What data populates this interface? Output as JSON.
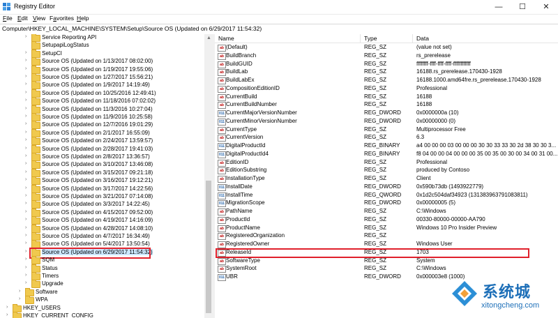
{
  "window": {
    "title": "Registry Editor",
    "minimize": "—",
    "maximize": "☐",
    "close": "✕"
  },
  "menu": [
    {
      "label": "File",
      "u": "F",
      "rest": "ile"
    },
    {
      "label": "Edit",
      "u": "E",
      "rest": "dit"
    },
    {
      "label": "View",
      "u": "V",
      "rest": "iew"
    },
    {
      "label": "Favorites",
      "u": "a",
      "pre": "F",
      "rest": "vorites"
    },
    {
      "label": "Help",
      "u": "H",
      "rest": "elp"
    }
  ],
  "address": "Computer\\HKEY_LOCAL_MACHINE\\SYSTEM\\Setup\\Source OS (Updated on 6/29/2017 11:54:32)",
  "tree": [
    {
      "label": "Service Reporting API",
      "indent": 3,
      "exp": "›"
    },
    {
      "label": "SetupapiLogStatus",
      "indent": 3,
      "exp": ""
    },
    {
      "label": "SetupCI",
      "indent": 3,
      "exp": "›"
    },
    {
      "label": "Source OS (Updated on 1/13/2017 08:02:00)",
      "indent": 3,
      "exp": "›"
    },
    {
      "label": "Source OS (Updated on 1/19/2017 19:55:06)",
      "indent": 3,
      "exp": "›"
    },
    {
      "label": "Source OS (Updated on 1/27/2017 15:56:21)",
      "indent": 3,
      "exp": "›"
    },
    {
      "label": "Source OS (Updated on 1/9/2017 14:19:49)",
      "indent": 3,
      "exp": "›"
    },
    {
      "label": "Source OS (Updated on 10/25/2016 12:49:41)",
      "indent": 3,
      "exp": "›"
    },
    {
      "label": "Source OS (Updated on 11/18/2016 07:02:02)",
      "indent": 3,
      "exp": "›"
    },
    {
      "label": "Source OS (Updated on 11/3/2016 10:27:04)",
      "indent": 3,
      "exp": "›"
    },
    {
      "label": "Source OS (Updated on 11/9/2016 10:25:58)",
      "indent": 3,
      "exp": "›"
    },
    {
      "label": "Source OS (Updated on 12/7/2016 19:01:29)",
      "indent": 3,
      "exp": "›"
    },
    {
      "label": "Source OS (Updated on 2/1/2017 16:55:09)",
      "indent": 3,
      "exp": "›"
    },
    {
      "label": "Source OS (Updated on 2/24/2017 13:59:57)",
      "indent": 3,
      "exp": "›"
    },
    {
      "label": "Source OS (Updated on 2/28/2017 19:41:03)",
      "indent": 3,
      "exp": "›"
    },
    {
      "label": "Source OS (Updated on 2/8/2017 13:36:57)",
      "indent": 3,
      "exp": "›"
    },
    {
      "label": "Source OS (Updated on 3/10/2017 13:46:08)",
      "indent": 3,
      "exp": "›"
    },
    {
      "label": "Source OS (Updated on 3/15/2017 09:21:18)",
      "indent": 3,
      "exp": "›"
    },
    {
      "label": "Source OS (Updated on 3/16/2017 19:12:21)",
      "indent": 3,
      "exp": "›"
    },
    {
      "label": "Source OS (Updated on 3/17/2017 14:22:56)",
      "indent": 3,
      "exp": "›"
    },
    {
      "label": "Source OS (Updated on 3/21/2017 07:14:08)",
      "indent": 3,
      "exp": "›"
    },
    {
      "label": "Source OS (Updated on 3/3/2017 14:22:45)",
      "indent": 3,
      "exp": "›"
    },
    {
      "label": "Source OS (Updated on 4/15/2017 09:52:00)",
      "indent": 3,
      "exp": "›"
    },
    {
      "label": "Source OS (Updated on 4/19/2017 14:16:09)",
      "indent": 3,
      "exp": "›"
    },
    {
      "label": "Source OS (Updated on 4/28/2017 14:08:10)",
      "indent": 3,
      "exp": "›"
    },
    {
      "label": "Source OS (Updated on 4/7/2017 16:34:49)",
      "indent": 3,
      "exp": "›"
    },
    {
      "label": "Source OS (Updated on 5/4/2017 13:50:54)",
      "indent": 3,
      "exp": "›"
    },
    {
      "label": "Source OS (Updated on 6/29/2017 11:54:32)",
      "indent": 3,
      "exp": "›",
      "selected": true
    },
    {
      "label": "SQM",
      "indent": 3,
      "exp": "›"
    },
    {
      "label": "Status",
      "indent": 3,
      "exp": "›"
    },
    {
      "label": "Timers",
      "indent": 3,
      "exp": "›"
    },
    {
      "label": "Upgrade",
      "indent": 3,
      "exp": "›"
    },
    {
      "label": "Software",
      "indent": 2,
      "exp": "›"
    },
    {
      "label": "WPA",
      "indent": 2,
      "exp": "›"
    },
    {
      "label": "HKEY_USERS",
      "indent": 1,
      "exp": "›"
    },
    {
      "label": "HKEY_CURRENT_CONFIG",
      "indent": 1,
      "exp": "›"
    }
  ],
  "columns": {
    "name": "Name",
    "type": "Type",
    "data": "Data"
  },
  "values": [
    {
      "name": "(Default)",
      "type": "REG_SZ",
      "data": "(value not set)",
      "kind": "sz"
    },
    {
      "name": "BuildBranch",
      "type": "REG_SZ",
      "data": "rs_prerelease",
      "kind": "sz"
    },
    {
      "name": "BuildGUID",
      "type": "REG_SZ",
      "data": "ffffffff-ffff-ffff-ffff-ffffffffffff",
      "kind": "sz"
    },
    {
      "name": "BuildLab",
      "type": "REG_SZ",
      "data": "16188.rs_prerelease.170430-1928",
      "kind": "sz"
    },
    {
      "name": "BuildLabEx",
      "type": "REG_SZ",
      "data": "16188.1000.amd64fre.rs_prerelease.170430-1928",
      "kind": "sz"
    },
    {
      "name": "CompositionEditionID",
      "type": "REG_SZ",
      "data": "Professional",
      "kind": "sz"
    },
    {
      "name": "CurrentBuild",
      "type": "REG_SZ",
      "data": "16188",
      "kind": "sz"
    },
    {
      "name": "CurrentBuildNumber",
      "type": "REG_SZ",
      "data": "16188",
      "kind": "sz"
    },
    {
      "name": "CurrentMajorVersionNumber",
      "type": "REG_DWORD",
      "data": "0x0000000a (10)",
      "kind": "bin"
    },
    {
      "name": "CurrentMinorVersionNumber",
      "type": "REG_DWORD",
      "data": "0x00000000 (0)",
      "kind": "bin"
    },
    {
      "name": "CurrentType",
      "type": "REG_SZ",
      "data": "Multiprocessor Free",
      "kind": "sz"
    },
    {
      "name": "CurrentVersion",
      "type": "REG_SZ",
      "data": "6.3",
      "kind": "sz"
    },
    {
      "name": "DigitalProductId",
      "type": "REG_BINARY",
      "data": "a4 00 00 00 03 00 00 00 30 30 33 33 30 2d 38 30 30 3...",
      "kind": "bin"
    },
    {
      "name": "DigitalProductId4",
      "type": "REG_BINARY",
      "data": "f8 04 00 00 04 00 00 00 35 00 35 00 30 00 34 00 31 00...",
      "kind": "bin"
    },
    {
      "name": "EditionID",
      "type": "REG_SZ",
      "data": "Professional",
      "kind": "sz"
    },
    {
      "name": "EditionSubstring",
      "type": "REG_SZ",
      "data": "produced by Contoso",
      "kind": "sz"
    },
    {
      "name": "InstallationType",
      "type": "REG_SZ",
      "data": "Client",
      "kind": "sz"
    },
    {
      "name": "InstallDate",
      "type": "REG_DWORD",
      "data": "0x590b73db (1493922779)",
      "kind": "bin"
    },
    {
      "name": "InstallTime",
      "type": "REG_QWORD",
      "data": "0x1d2c504daf34923 (131383963791083811)",
      "kind": "bin"
    },
    {
      "name": "MigrationScope",
      "type": "REG_DWORD",
      "data": "0x00000005 (5)",
      "kind": "bin"
    },
    {
      "name": "PathName",
      "type": "REG_SZ",
      "data": "C:\\Windows",
      "kind": "sz"
    },
    {
      "name": "ProductId",
      "type": "REG_SZ",
      "data": "00330-80000-00000-AA790",
      "kind": "sz"
    },
    {
      "name": "ProductName",
      "type": "REG_SZ",
      "data": "Windows 10 Pro Insider Preview",
      "kind": "sz"
    },
    {
      "name": "RegisteredOrganization",
      "type": "REG_SZ",
      "data": "",
      "kind": "sz"
    },
    {
      "name": "RegisteredOwner",
      "type": "REG_SZ",
      "data": "Windows User",
      "kind": "sz"
    },
    {
      "name": "ReleaseId",
      "type": "REG_SZ",
      "data": "1703",
      "kind": "sz",
      "highlight": true
    },
    {
      "name": "SoftwareType",
      "type": "REG_SZ",
      "data": "System",
      "kind": "sz"
    },
    {
      "name": "SystemRoot",
      "type": "REG_SZ",
      "data": "C:\\Windows",
      "kind": "sz"
    },
    {
      "name": "UBR",
      "type": "REG_DWORD",
      "data": "0x000003e8 (1000)",
      "kind": "bin"
    }
  ],
  "icons": {
    "sz": "ab",
    "bin": "011"
  },
  "watermark": {
    "brand": "系统城",
    "url": "xitongcheng.com"
  },
  "colors": {
    "highlight_border": "#e0202b",
    "selection": "#cce8ff",
    "folder": "#f0c94e",
    "brand": "#1d6fb8"
  }
}
